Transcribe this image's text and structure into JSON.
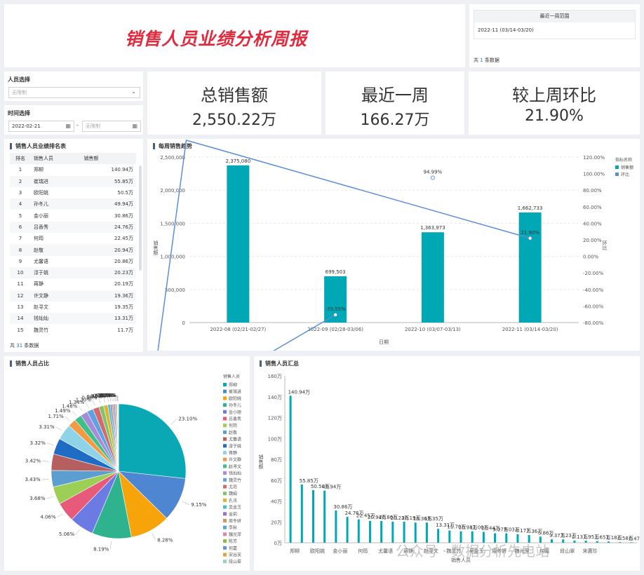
{
  "title": "销售人员业绩分析周报",
  "recent_panel": {
    "header": "最近一周范围",
    "value": "2022-11 (03/14-03/20)",
    "count_prefix": "共",
    "count_value": "1",
    "count_suffix": "条数据"
  },
  "filters": {
    "person_label": "人员选择",
    "person_placeholder": "无限制",
    "time_label": "时间选择",
    "date_start": "2022-02-21",
    "date_sep": "-",
    "date_end_placeholder": "无限制"
  },
  "kpis": [
    {
      "label": "总销售额",
      "value": "2,550.22万"
    },
    {
      "label": "最近一周",
      "value": "166.27万"
    },
    {
      "label": "较上周环比",
      "value": "21.90%"
    }
  ],
  "ranking": {
    "title": "销售人员业绩排名表",
    "columns": [
      "排名",
      "销售人员",
      "销售额"
    ],
    "rows": [
      [
        "1",
        "郑柳",
        "140.94万"
      ],
      [
        "2",
        "崔瑞进",
        "55.85万"
      ],
      [
        "3",
        "欧阳姚",
        "50.5万"
      ],
      [
        "4",
        "孙冬儿",
        "49.94万"
      ],
      [
        "5",
        "金小丽",
        "30.86万"
      ],
      [
        "6",
        "吕香秀",
        "24.76万"
      ],
      [
        "7",
        "何筠",
        "22.45万"
      ],
      [
        "8",
        "赵敬",
        "20.94万"
      ],
      [
        "9",
        "尤馨语",
        "20.86万"
      ],
      [
        "10",
        "淳于姚",
        "20.23万"
      ],
      [
        "11",
        "蒋静",
        "20.19万"
      ],
      [
        "12",
        "许文静",
        "19.36万"
      ],
      [
        "13",
        "赵寻文",
        "19.35万"
      ],
      [
        "14",
        "钱灿灿",
        "13.31万"
      ],
      [
        "15",
        "魏灵竹",
        "11.7万"
      ]
    ],
    "footer_prefix": "共",
    "footer_value": "31",
    "footer_suffix": "条数据"
  },
  "colors": {
    "teal": "#00a8b5",
    "line": "#5b8fd6"
  },
  "chart_data": [
    {
      "type": "bar",
      "title": "每周销售趋势",
      "xlabel": "日期",
      "ylabel": "销售额",
      "y2label": "环比",
      "categories": [
        "2022-08 (02/21-02/27)",
        "2022-09 (02/28-03/06)",
        "2022-10 (03/07-03/13)",
        "2022-11 (03/14-03/20)"
      ],
      "series": [
        {
          "name": "销售额",
          "type": "bar",
          "values": [
            2375080,
            699503,
            1363973,
            1662733
          ],
          "labels": [
            "2,375,080",
            "699,503",
            "1,363,973",
            "1,662,733"
          ]
        },
        {
          "name": "环比",
          "type": "line",
          "values": [
            null,
            -70.55,
            94.99,
            21.9
          ],
          "labels": [
            "",
            "-70.55%",
            "94.99%",
            "21.90%"
          ]
        }
      ],
      "ylim": [
        0,
        2500000
      ],
      "y2lim": [
        -80,
        120
      ],
      "yticks": [
        "0",
        "500,000",
        "1,000,000",
        "1,500,000",
        "2,000,000",
        "2,500,000"
      ],
      "y2ticks": [
        "-80.00%",
        "-60.00%",
        "-40.00%",
        "-20.00%",
        "0.00%",
        "20.00%",
        "40.00%",
        "60.00%",
        "80.00%",
        "100.00%",
        "120.00%"
      ],
      "legend_title": "指标名称",
      "legend": [
        "销售额",
        "环比"
      ],
      "legend_position": "top-right"
    },
    {
      "type": "pie",
      "title": "销售人员占比",
      "legend_title": "销售人员",
      "legend_position": "right",
      "labels": [
        "郑柳",
        "崔瑞进",
        "欧阳姚",
        "孙冬儿",
        "金小丽",
        "吕香秀",
        "何筠",
        "赵敬",
        "尤馨语",
        "淳于姚",
        "蒋静",
        "许文静",
        "赵寻文",
        "钱灿灿",
        "魏灵竹",
        "尤培",
        "魏娟",
        "孔讯",
        "吴金玉",
        "金莉",
        "周冬妍",
        "李秋",
        "魏光萍",
        "陈芳",
        "何嘉",
        "宋谷芙",
        "段山翠"
      ],
      "percents": [
        "23.10%",
        "9.15%",
        "8.28%",
        "8.19%",
        "5.06%",
        "4.06%",
        "3.68%",
        "3.43%",
        "3.42%",
        "3.32%",
        "3.31%",
        "1.71%",
        "1.49%",
        "1.48%",
        "1.34%",
        "1.30%",
        "0.96%",
        "0.86%",
        "0.53%",
        "0.35%",
        "0.32%",
        "0.32%",
        "0.27%",
        "0.19%",
        "0.10%",
        "0.08%"
      ],
      "values": [
        23.1,
        9.15,
        8.28,
        8.19,
        5.06,
        4.06,
        3.68,
        3.43,
        3.42,
        3.32,
        3.31,
        1.71,
        1.49,
        1.48,
        1.34,
        1.3,
        0.96,
        0.86,
        0.53,
        0.35,
        0.32,
        0.32,
        0.27,
        0.19,
        0.1,
        0.08,
        0.08
      ],
      "colors": [
        "#0aa8b5",
        "#4f86d1",
        "#f7a30a",
        "#2fb38f",
        "#6b7be3",
        "#e85a7a",
        "#9ccf56",
        "#5b9ecf",
        "#b55f5f",
        "#1f6cc4",
        "#8fd3e8",
        "#f29a44",
        "#3fbf8a",
        "#a78bd8",
        "#5fa2e3",
        "#d46a6a",
        "#7fc46b",
        "#e0b23a",
        "#4ac0c9",
        "#9a72c9",
        "#c99a5a",
        "#58a6d6",
        "#e77fa8",
        "#8cbf3f",
        "#6b8fd1",
        "#d9a441",
        "#9bd0c0"
      ]
    },
    {
      "type": "bar",
      "title": "销售人员汇总",
      "xlabel": "销售人员",
      "ylabel": "销售额",
      "ylim": [
        0,
        160
      ],
      "yticks": [
        "0万",
        "20万",
        "40万",
        "60万",
        "80万",
        "100万",
        "120万",
        "140万",
        "160万"
      ],
      "tick_labels": [
        "郑柳",
        "欧阳姚",
        "金小丽",
        "何筠",
        "尤馨语",
        "蒋静",
        "赵寻文",
        "魏灵竹",
        "吴金玉",
        "周冬妍",
        "魏光萍",
        "何嘉",
        "段山翠",
        "宋惠珍"
      ],
      "values": [
        140.94,
        55.85,
        50.5,
        49.94,
        30.86,
        24.76,
        22.45,
        20.94,
        20.86,
        20.23,
        20.19,
        19.36,
        19.35,
        13.31,
        11.7,
        10.98,
        11.0,
        10.44,
        9.07,
        9.03,
        8.17,
        7.36,
        5.86,
        3.37,
        3.23,
        2.13,
        1.95,
        1.65,
        1.18,
        0.58,
        0.47
      ],
      "labels": [
        "140.94万",
        "55.85万",
        "50.50万",
        "49.94万",
        "30.86万",
        "24.76万",
        "22.45万",
        "20.94万",
        "20.86万",
        "20.23万",
        "20.19万",
        "19.36万",
        "19.35万",
        "13.31万",
        "11.70万",
        "10.98万",
        "11.00万",
        "10.44万",
        "9.07万",
        "9.03万",
        "8.17万",
        "7.36万",
        "5.86万",
        "3.37万",
        "3.23万",
        "2.13万",
        "1.95万",
        "1.65万",
        "1.18万",
        "0.58万",
        "0.47万"
      ]
    }
  ],
  "watermark": "公众号 · 数据分析先电站"
}
